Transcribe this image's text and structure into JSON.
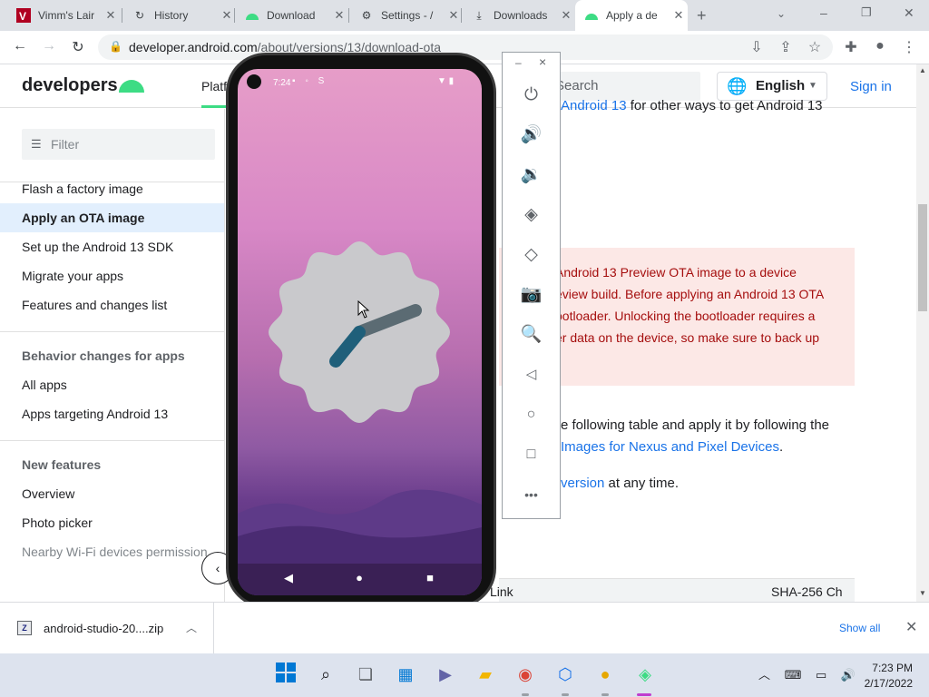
{
  "browser": {
    "tabs": [
      {
        "label": "Vimm's Lair",
        "icon": "vimm-icon"
      },
      {
        "label": "History",
        "icon": "history-icon"
      },
      {
        "label": "Download",
        "icon": "android-icon"
      },
      {
        "label": "Settings - /",
        "icon": "gear-icon"
      },
      {
        "label": "Downloads",
        "icon": "download-icon"
      },
      {
        "label": "Apply a de",
        "icon": "android-icon"
      }
    ],
    "url_host": "developer.android.com",
    "url_path": "/about/versions/13/download-ota"
  },
  "site": {
    "logo": "developers",
    "nav_platform": "Platf",
    "search_placeholder": "Search",
    "language": "English",
    "signin": "Sign in"
  },
  "sidenav": {
    "filter_placeholder": "Filter",
    "items_top": [
      "Flash a factory image",
      "Apply an OTA image",
      "Set up the Android 13 SDK",
      "Migrate your apps",
      "Features and changes list"
    ],
    "active_item": "Apply an OTA image",
    "section_behavior": "Behavior changes for apps",
    "items_behavior": [
      "All apps",
      "Apps targeting Android 13"
    ],
    "section_features": "New features",
    "items_features": [
      "Overview",
      "Photo picker",
      "Nearby Wi-Fi devices permission"
    ]
  },
  "content": {
    "line_top_link": "Android 13",
    "line_top_rest": "for other ways to get Android 13",
    "warning_lines": [
      "Android 13 Preview OTA image to a device",
      "eview build. Before applying an Android 13 OTA",
      "ootloader. Unlocking the bootloader requires a",
      "er data on the device, so make sure to back up"
    ],
    "para1_line1": "e following table and apply it by following the",
    "para1_link": "Images for Nexus and Pixel Devices",
    "para1_end": ".",
    "para2_link": "version",
    "para2_rest": "at any time.",
    "table_head_left": "Link",
    "table_head_right": "SHA-256 Ch"
  },
  "emulator": {
    "minimize": "–",
    "close": "×",
    "buttons": [
      "power-icon",
      "volume-up-icon",
      "volume-down-icon",
      "rotate-left-icon",
      "rotate-right-icon",
      "camera-icon",
      "zoom-icon",
      "back-icon",
      "home-icon",
      "overview-icon",
      "more-icon"
    ]
  },
  "phone": {
    "time": "7:24",
    "accent_hand": "#1f5f7a",
    "hand_color": "#5b6b73",
    "clock_face": "#c9c9cc"
  },
  "download_bar": {
    "filename": "android-studio-20....zip",
    "show_all": "Show all"
  },
  "taskbar": {
    "time": "7:23 PM",
    "date": "2/17/2022"
  }
}
